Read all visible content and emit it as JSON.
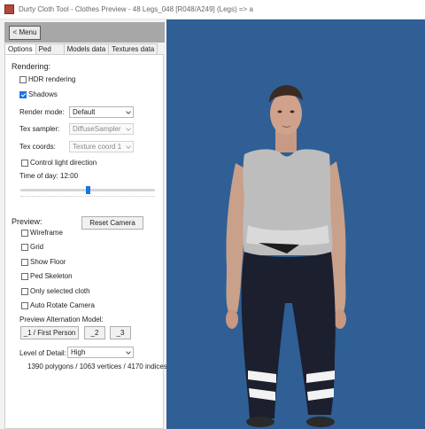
{
  "window": {
    "title": "Durty Cloth Tool - Clothes Preview - 48 Legs_048 [R048/A249] (Legs) => a"
  },
  "menu": {
    "label": "< Menu"
  },
  "tabs": [
    "Options",
    "Ped",
    "Models data",
    "Textures data"
  ],
  "active_tab": "Options",
  "rendering": {
    "heading": "Rendering:",
    "hdr": {
      "label": "HDR rendering",
      "checked": false
    },
    "shadows": {
      "label": "Shadows",
      "checked": true
    },
    "render_mode": {
      "label": "Render mode:",
      "value": "Default"
    },
    "tex_sampler": {
      "label": "Tex sampler:",
      "value": "DiffuseSampler"
    },
    "tex_coords": {
      "label": "Tex coords:",
      "value": "Texture coord 1"
    },
    "light_dir": {
      "label": "Control light direction",
      "checked": false
    },
    "time_of_day": {
      "label": "Time of day:",
      "value": "12:00",
      "fraction": 0.5
    }
  },
  "preview": {
    "heading": "Preview:",
    "reset_camera": "Reset Camera",
    "wireframe": {
      "label": "Wireframe",
      "checked": false
    },
    "grid": {
      "label": "Grid",
      "checked": false
    },
    "show_floor": {
      "label": "Show Floor",
      "checked": false
    },
    "ped_skeleton": {
      "label": "Ped Skeleton",
      "checked": false
    },
    "only_selected": {
      "label": "Only selected cloth",
      "checked": false
    },
    "auto_rotate": {
      "label": "Auto Rotate Camera",
      "checked": false
    },
    "alternation_label": "Preview Alternation Model:",
    "alt_buttons": [
      "_1 / First Person",
      "_2",
      "_3"
    ],
    "lod": {
      "label": "Level of Detail:",
      "value": "High"
    },
    "stats": "1390 polygons / 1063 vertices / 4170 indices"
  },
  "colors": {
    "viewport_bg": "#2f5f94",
    "accent": "#1a73e8",
    "menu_bar": "#a7a7a7"
  }
}
